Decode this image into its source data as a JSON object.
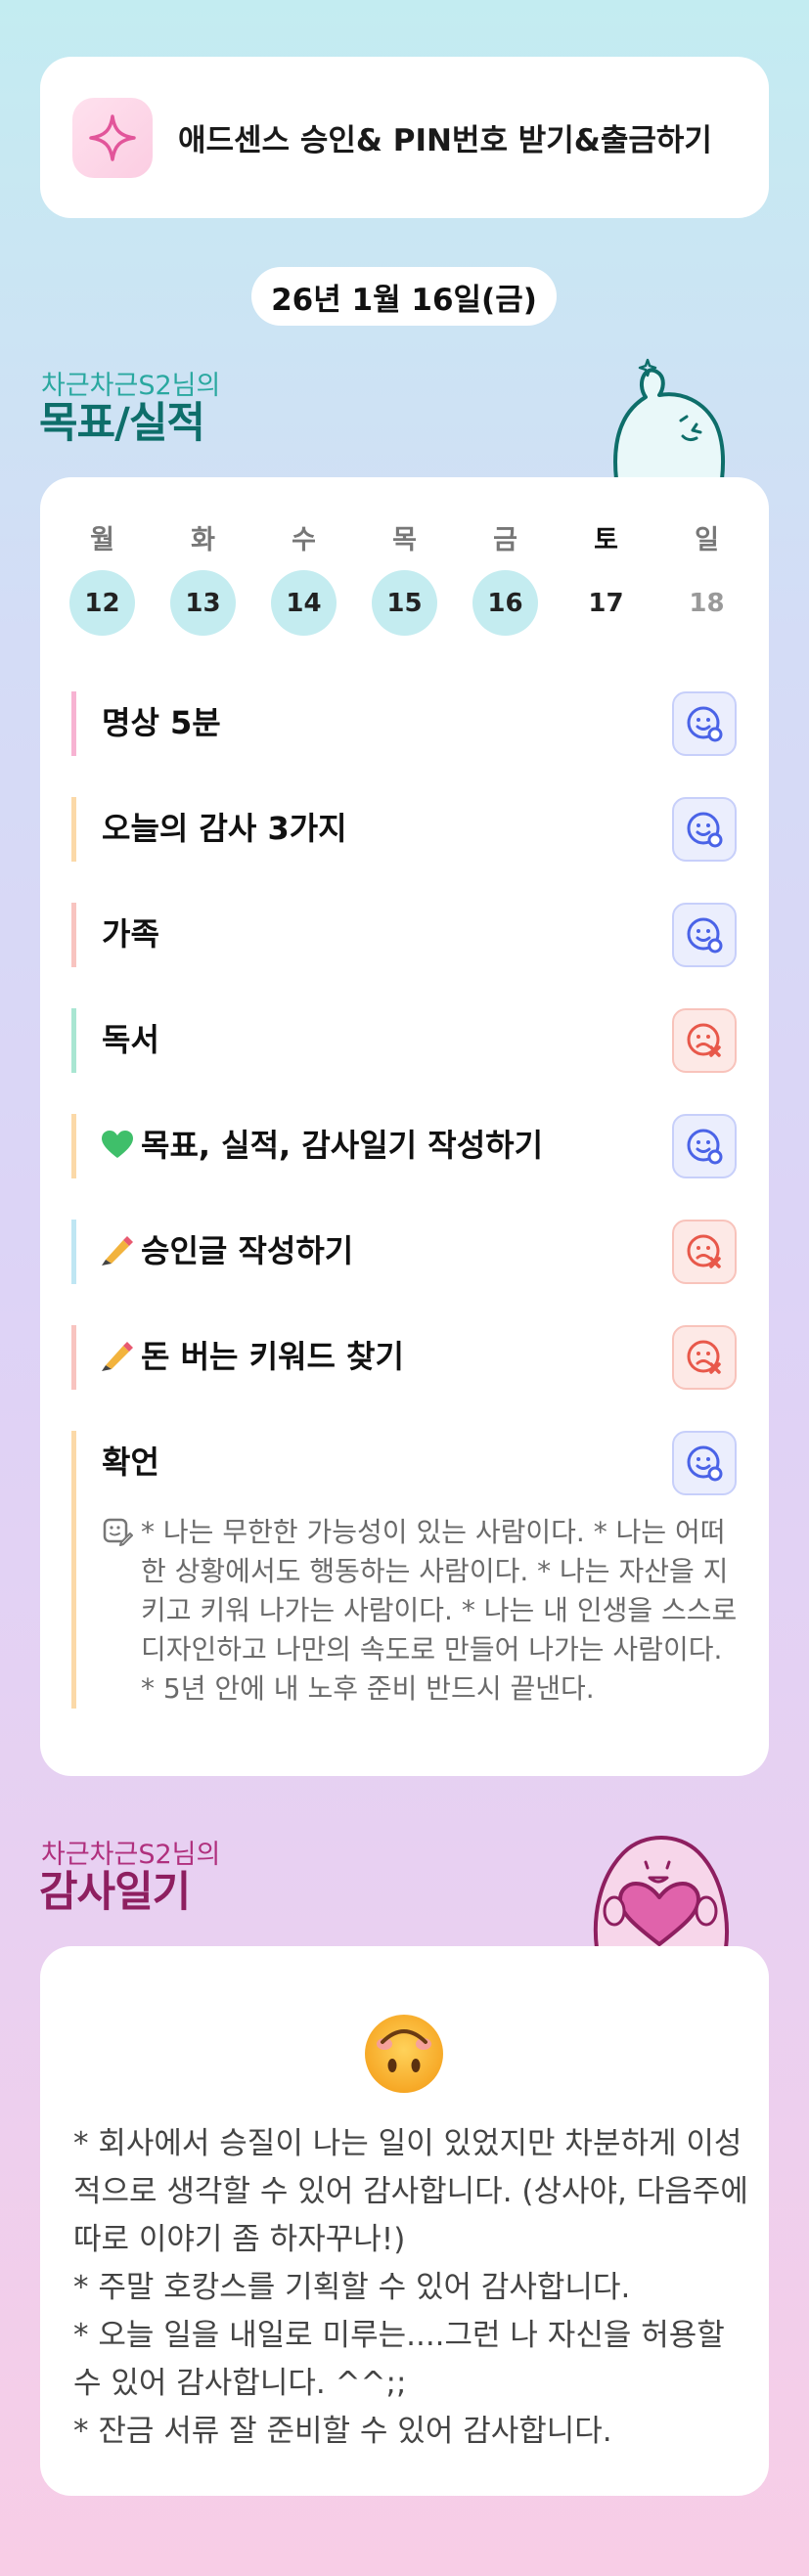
{
  "header": {
    "icon": "sparkle-icon",
    "title": "애드센스 승인& PIN번호 받기&출금하기"
  },
  "date_label": "26년 1월 16일(금)",
  "goals_section": {
    "subtitle": "차근차근S2님의",
    "title": "목표/실적"
  },
  "week": {
    "days": [
      {
        "dow": "월",
        "date": "12",
        "done": true
      },
      {
        "dow": "화",
        "date": "13",
        "done": true
      },
      {
        "dow": "수",
        "date": "14",
        "done": true
      },
      {
        "dow": "목",
        "date": "15",
        "done": true
      },
      {
        "dow": "금",
        "date": "16",
        "done": true
      },
      {
        "dow": "토",
        "date": "17",
        "done": false
      },
      {
        "dow": "일",
        "date": "18",
        "done": false
      }
    ]
  },
  "goals": [
    {
      "title": "명상 5분",
      "status": "done",
      "icon": "smile-check-icon",
      "bar_color": "#f7b3d2"
    },
    {
      "title": "오늘의 감사 3가지",
      "status": "done",
      "icon": "smile-check-icon",
      "bar_color": "#fbd9a8"
    },
    {
      "title": "가족",
      "status": "done",
      "icon": "smile-check-icon",
      "bar_color": "#f8c4c0"
    },
    {
      "title": "독서",
      "status": "fail",
      "icon": "frown-x-icon",
      "bar_color": "#a9e6d2"
    },
    {
      "title": "목표, 실적, 감사일기 작성하기",
      "prefix": "💚",
      "status": "done",
      "icon": "smile-check-icon",
      "bar_color": "#fbd9a8"
    },
    {
      "title": "승인글 작성하기",
      "prefix": "✍",
      "status": "fail",
      "icon": "frown-x-icon",
      "bar_color": "#bfe6f3"
    },
    {
      "title": "돈 버는 키워드 찾기",
      "prefix": "✍",
      "status": "fail",
      "icon": "frown-x-icon",
      "bar_color": "#f8c4c0"
    },
    {
      "title": "확언",
      "status": "done",
      "icon": "smile-check-icon",
      "bar_color": "#fbd9a8"
    }
  ],
  "affirmation_memo": "* 나는 무한한 가능성이 있는 사람이다. * 나는 어떠한 상황에서도 행동하는 사람이다. * 나는 자산을 지키고 키워 나가는 사람이다. * 나는 내 인생을 스스로 디자인하고 나만의 속도로 만들어 나가는 사람이다. * 5년 안에 내 노후 준비 반드시 끝낸다.",
  "gratitude_section": {
    "subtitle": "차근차근S2님의",
    "title": "감사일기"
  },
  "gratitude": {
    "mood_icon": "upside-down-face-icon",
    "text": "* 회사에서 승질이 나는 일이 있었지만 차분하게 이성적으로 생각할 수 있어 감사합니다. (상사야, 다음주에 따로 이야기 좀 하자꾸나!)\n* 주말 호캉스를 기획할 수 있어 감사합니다.\n* 오늘 일을 내일로 미루는....그런 나 자신을 허용할 수 있어 감사합니다. ^^;;\n* 잔금 서류 잘 준비할 수 있어 감사합니다."
  },
  "colors": {
    "accent_teal": "#0e6e6a",
    "accent_pink": "#8e1f60",
    "done_circle": "#c4ecf0",
    "success_icon": "#4a63e7",
    "fail_icon": "#e8584a"
  }
}
